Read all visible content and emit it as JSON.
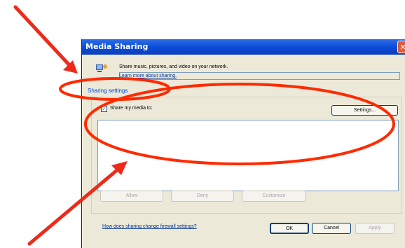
{
  "dialog": {
    "title": "Media Sharing",
    "description": "Share music, pictures, and video on your network.",
    "learn_more_link": "Learn more about sharing.",
    "settings_label": "Sharing settings",
    "share_checkbox_label": "Share my media to:",
    "share_checked": true,
    "settings_button": "Settings...",
    "allow_button": "Allow",
    "deny_button": "Deny",
    "customize_button": "Customize",
    "firewall_link": "How does sharing change firewall settings?",
    "ok_button": "OK",
    "cancel_button": "Cancel",
    "apply_button": "Apply"
  },
  "annotation": {
    "color": "#ff2a00",
    "arrow_color": "#ee2a1b"
  },
  "icons": {
    "close": "close-icon",
    "media": "media-sharing-icon",
    "check": "checkmark-icon"
  }
}
